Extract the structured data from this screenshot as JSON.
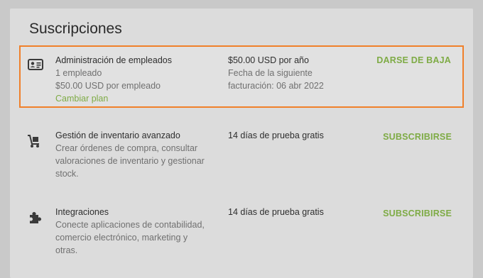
{
  "title": "Suscripciones",
  "items": [
    {
      "icon": "id-card-icon",
      "name": "Administración de empleados",
      "lines": [
        "1 empleado",
        "$50.00 USD por empleado"
      ],
      "link": "Cambiar plan",
      "price": "$50.00 USD por año",
      "price_sub": [
        "Fecha de la siguiente",
        "facturación: 06 abr 2022"
      ],
      "action": "DARSE DE BAJA"
    },
    {
      "icon": "hand-truck-icon",
      "name": "Gestión de inventario avanzado",
      "lines": [
        "Crear órdenes de compra, consultar",
        "valoraciones de inventario y gestionar",
        "stock."
      ],
      "price": "14 días de prueba gratis",
      "action": "SUBSCRIBIRSE"
    },
    {
      "icon": "puzzle-piece-icon",
      "name": "Integraciones",
      "lines": [
        "Conecte aplicaciones de contabilidad,",
        "comercio electrónico, marketing y",
        "otras."
      ],
      "price": "14 días de prueba gratis",
      "action": "SUBSCRIBIRSE"
    }
  ],
  "colors": {
    "accent": "#7eab45",
    "highlight_border": "#f0802a"
  }
}
